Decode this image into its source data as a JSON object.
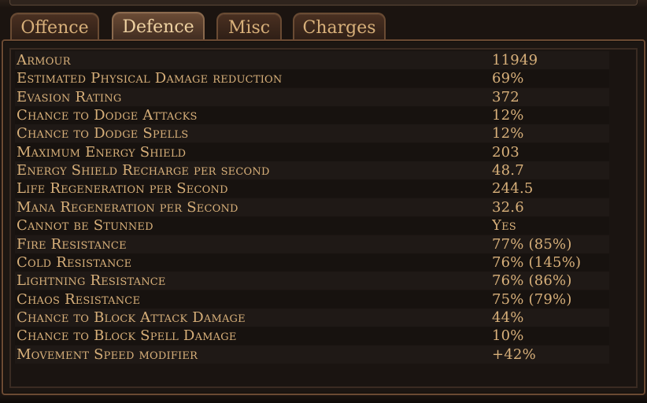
{
  "tabs": [
    {
      "label": "Offence",
      "active": false
    },
    {
      "label": "Defence",
      "active": true
    },
    {
      "label": "Misc",
      "active": false
    },
    {
      "label": "Charges",
      "active": false
    }
  ],
  "stats": [
    {
      "name": "Armour",
      "value": "11949"
    },
    {
      "name": "Estimated Physical Damage reduction",
      "value": "69%"
    },
    {
      "name": "Evasion Rating",
      "value": "372"
    },
    {
      "name": "Chance to Dodge Attacks",
      "value": "12%"
    },
    {
      "name": "Chance to Dodge Spells",
      "value": "12%"
    },
    {
      "name": "Maximum Energy Shield",
      "value": "203"
    },
    {
      "name": "Energy Shield Recharge per second",
      "value": "48.7"
    },
    {
      "name": "Life Regeneration per Second",
      "value": "244.5"
    },
    {
      "name": "Mana Regeneration per Second",
      "value": "32.6"
    },
    {
      "name": "Cannot be Stunned",
      "value": "Yes"
    },
    {
      "name": "Fire Resistance",
      "value": "77% (85%)"
    },
    {
      "name": "Cold Resistance",
      "value": "76% (145%)"
    },
    {
      "name": "Lightning Resistance",
      "value": "76% (86%)"
    },
    {
      "name": "Chaos Resistance",
      "value": "75% (79%)"
    },
    {
      "name": "Chance to Block Attack Damage",
      "value": "44%"
    },
    {
      "name": "Chance to Block Spell Damage",
      "value": "10%"
    },
    {
      "name": "Movement Speed modifier",
      "value": "+42%"
    }
  ],
  "colors": {
    "text": "#d8b07a",
    "tab_active_text": "#efd2a2",
    "border": "#6b4a33",
    "background": "#1a1411"
  }
}
